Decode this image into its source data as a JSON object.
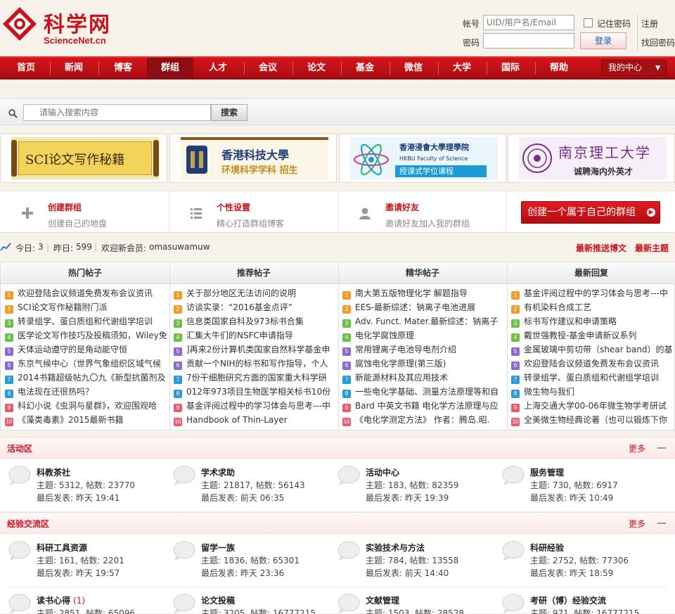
{
  "brand": {
    "name_cn": "科学网",
    "name_en": "ScienceNet.cn"
  },
  "login": {
    "account_label": "帐号",
    "account_placeholder": "UID/用户名/Email",
    "remember_label": "记住密码",
    "register": "注册",
    "password_label": "密码",
    "login_button": "登录",
    "forgot": "找回密码"
  },
  "nav": {
    "items": [
      "首页",
      "新闻",
      "博客",
      "群组",
      "人才",
      "会议",
      "论文",
      "基金",
      "微信",
      "大学",
      "国际",
      "帮助"
    ],
    "active": "群组",
    "my_center": "我的中心"
  },
  "search": {
    "placeholder": "请输入搜索内容",
    "button": "搜索"
  },
  "banners": [
    {
      "name": "SCI论文写作秘籍"
    },
    {
      "name": "香港科技大學",
      "sub": "环境科学学科 招生"
    },
    {
      "name": "香港浸會大學理學院",
      "sub_en": "HKBU Faculty of Science",
      "sub": "授课式学位课程"
    },
    {
      "name": "南京理工大学",
      "sub": "诚聘海内外英才"
    }
  ],
  "actions": [
    {
      "title": "创建群组",
      "sub": "创建自己的地盘",
      "icon": "plus-icon"
    },
    {
      "title": "个性设置",
      "sub": "精心打造群组博客",
      "icon": "list-icon"
    },
    {
      "title": "邀请好友",
      "sub": "邀请好友加入我的群组",
      "icon": "user-icon"
    }
  ],
  "create_button": "创建一个属于自己的群组",
  "stats": {
    "today_label": "今日:",
    "today": "3",
    "yesterday_label": "昨日:",
    "yesterday": "599",
    "welcome_label": "欢迎新会员:",
    "new_member": "omasuwamuw",
    "link1": "最新推送博文",
    "link2": "最新主题"
  },
  "columns": [
    {
      "title": "热门帖子",
      "posts": [
        "欢迎登陆会议频道免费发布会议资讯",
        "SCI论文写作秘籍附门派",
        "转录组学、蛋白质组和代谢组学培训",
        "医学论文写作技巧及投稿须知，Wiley免",
        "天体运动遵守的是角动能守恒",
        "东京气候中心（世界气象组织区域气候",
        "2014书籍超级帖九〇九《新型抗菌剂及",
        "电法现在还很热吗？",
        "科幻小说《虫洞与星群》，欢迎围观哈",
        "《藻类毒素》2015最新书籍"
      ]
    },
    {
      "title": "推荐帖子",
      "posts": [
        "关于部分地区无法访问的说明",
        "访谈实录：“2016基金点评”",
        "信息类国家自科及973标书合集",
        "汇集大牛们的NSFC申请指导",
        "]再来2份计算机类国家自然科学基金申",
        "贡献一个NIH的标书和写作指导，个人",
        "7份干细胞研究方面的国家重大科学研",
        "012年973项目生物医学相关标书10份",
        "基金评阅过程中的学习体会与思考---中",
        "Handbook of Thin-Layer"
      ]
    },
    {
      "title": "精华帖子",
      "posts": [
        "南大第五版物理化学 解题指导",
        "EES-最新综述：钠离子电池进展",
        "Adv. Funct. Mater.最新综述：钠离子",
        "电化学腐蚀原理",
        "常用锂离子电池导电剂介绍",
        "腐蚀电化学原理(第三版)",
        "新能源材料及其应用技术",
        "一些电化学基础、测量方法原理等和自",
        "Bard 中英文书籍 电化学方法原理与应",
        "《电化学测定方法》   作者：腾岛.昭."
      ]
    },
    {
      "title": "最新回复",
      "posts": [
        "基金评阅过程中的学习体会与思考---中",
        "有机染料合成工艺",
        "标书写作建议和申请策略",
        "戴世强教授-基金申请新议系列",
        "金属玻璃中剪切带（shear band）的基",
        "欢迎登陆会议频道免费发布会议资讯",
        "转录组学、蛋白质组和代谢组学培训",
        "微生物与我们",
        "上海交通大学00-06年微生物学考研试",
        "全美微生物经典论著（也可以锻炼下你"
      ]
    }
  ],
  "sections": [
    {
      "title": "活动区",
      "more": "更多",
      "forums": [
        {
          "name": "科教茶社",
          "count": "",
          "topics": "主题: 5312, 帖数: 23770",
          "last": "最后发表: 昨天 19:41"
        },
        {
          "name": "学术求助",
          "count": "",
          "topics": "主题: 21817, 帖数: 56143",
          "last": "最后发表: 前天 06:35"
        },
        {
          "name": "活动中心",
          "count": "",
          "topics": "主题: 183, 帖数: 82359",
          "last": "最后发表: 昨天 19:39"
        },
        {
          "name": "服务管理",
          "count": "",
          "topics": "主题: 730, 帖数: 6917",
          "last": "最后发表: 昨天 10:49"
        }
      ]
    },
    {
      "title": "经验交流区",
      "more": "更多",
      "forums": [
        {
          "name": "科研工具资源",
          "count": "",
          "topics": "主题: 161, 帖数: 2201",
          "last": "最后发表: 昨天 19:57"
        },
        {
          "name": "留学一族",
          "count": "",
          "topics": "主题: 1836, 帖数: 65301",
          "last": "最后发表: 昨天 23:36"
        },
        {
          "name": "实验技术与方法",
          "count": "",
          "topics": "主题: 784, 帖数: 13558",
          "last": "最后发表: 前天 14:40"
        },
        {
          "name": "科研经验",
          "count": "",
          "topics": "主题: 2752, 帖数: 77306",
          "last": "最后发表: 昨天 18:59"
        },
        {
          "name": "读书心得",
          "count": "(1)",
          "topics": "主题: 2851, 帖数: 65096",
          "last": ""
        },
        {
          "name": "论文投稿",
          "count": "",
          "topics": "主题: 3205, 帖数: 16777215",
          "last": ""
        },
        {
          "name": "文献管理",
          "count": "",
          "topics": "主题: 1503, 帖数: 28528",
          "last": ""
        },
        {
          "name": "考研（博）经验交流",
          "count": "",
          "topics": "主题: 971, 帖数: 16777215",
          "last": ""
        }
      ]
    }
  ],
  "colors": {
    "brand_red": "#c7131c",
    "nav_red": "#b8101a",
    "num_colors": [
      "#f29b2b",
      "#f29b2b",
      "#6cbf4a",
      "#6cbf4a",
      "#8a6ad1",
      "#8a6ad1",
      "#2c9ad8",
      "#2c9ad8",
      "#e85b6c",
      "#e85b6c"
    ]
  }
}
